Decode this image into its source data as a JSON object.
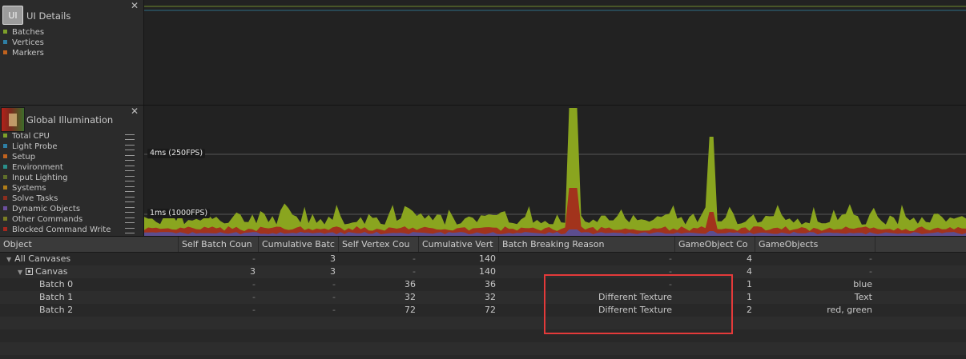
{
  "ui_details": {
    "icon_label": "UI",
    "title": "UI Details",
    "close_glyph": "✕",
    "legend": [
      {
        "label": "Batches",
        "color": "#7ea02a"
      },
      {
        "label": "Vertices",
        "color": "#2e7fa5"
      },
      {
        "label": "Markers",
        "color": "#c0621e"
      }
    ]
  },
  "global_illumination": {
    "title": "Global Illumination",
    "close_glyph": "✕",
    "legend": [
      {
        "label": "Total CPU",
        "color": "#7ea02a"
      },
      {
        "label": "Light Probe",
        "color": "#2e7fa5"
      },
      {
        "label": "Setup",
        "color": "#c0621e"
      },
      {
        "label": "Environment",
        "color": "#2a8f8a"
      },
      {
        "label": "Input Lighting",
        "color": "#5f6f2a"
      },
      {
        "label": "Systems",
        "color": "#b07d18"
      },
      {
        "label": "Solve Tasks",
        "color": "#8c2e1f"
      },
      {
        "label": "Dynamic Objects",
        "color": "#6b4f9e"
      },
      {
        "label": "Other Commands",
        "color": "#7a7d24"
      },
      {
        "label": "Blocked Command Write",
        "color": "#a3281f"
      }
    ],
    "time_labels": [
      "4ms (250FPS)",
      "1ms (1000FPS)"
    ]
  },
  "table": {
    "columns": [
      "Object",
      "Self Batch Coun",
      "Cumulative Batc",
      "Self Vertex Cou",
      "Cumulative Vert",
      "Batch Breaking Reason",
      "GameObject Co",
      "GameObjects"
    ],
    "rows": [
      {
        "name": "All Canvases",
        "self_batch": "-",
        "cum_batch": "3",
        "self_vertex": "-",
        "cum_vertex": "140",
        "reason": "-",
        "go_count": "4",
        "gameobjects": "-"
      },
      {
        "name": "Canvas",
        "self_batch": "3",
        "cum_batch": "3",
        "self_vertex": "-",
        "cum_vertex": "140",
        "reason": "-",
        "go_count": "4",
        "gameobjects": "-"
      },
      {
        "name": "Batch 0",
        "self_batch": "-",
        "cum_batch": "-",
        "self_vertex": "36",
        "cum_vertex": "36",
        "reason": "-",
        "go_count": "1",
        "gameobjects": "blue"
      },
      {
        "name": "Batch 1",
        "self_batch": "-",
        "cum_batch": "-",
        "self_vertex": "32",
        "cum_vertex": "32",
        "reason": "Different Texture",
        "go_count": "1",
        "gameobjects": "Text"
      },
      {
        "name": "Batch 2",
        "self_batch": "-",
        "cum_batch": "-",
        "self_vertex": "72",
        "cum_vertex": "72",
        "reason": "Different Texture",
        "go_count": "2",
        "gameobjects": "red, green"
      }
    ]
  },
  "highlight_color": "#e43a3a"
}
